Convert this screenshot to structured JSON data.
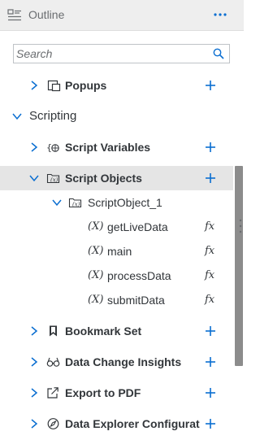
{
  "header": {
    "title": "Outline"
  },
  "search": {
    "placeholder": "Search"
  },
  "tree": {
    "popups": "Popups",
    "scripting": "Scripting",
    "script_variables": "Script Variables",
    "script_objects": "Script Objects",
    "script_object_1": "ScriptObject_1",
    "functions": [
      "getLiveData",
      "main",
      "processData",
      "submitData"
    ],
    "function_badge": "fx",
    "function_prefix": "(X)",
    "bookmark_set": "Bookmark Set",
    "data_change_insights": "Data Change Insights",
    "export_to_pdf": "Export to PDF",
    "data_explorer_configuration": "Data Explorer Configurat"
  },
  "colors": {
    "accent": "#0a6ed1",
    "text": "#32363a",
    "header_bg": "#eeeeee",
    "selected_bg": "#e5e5e5"
  }
}
